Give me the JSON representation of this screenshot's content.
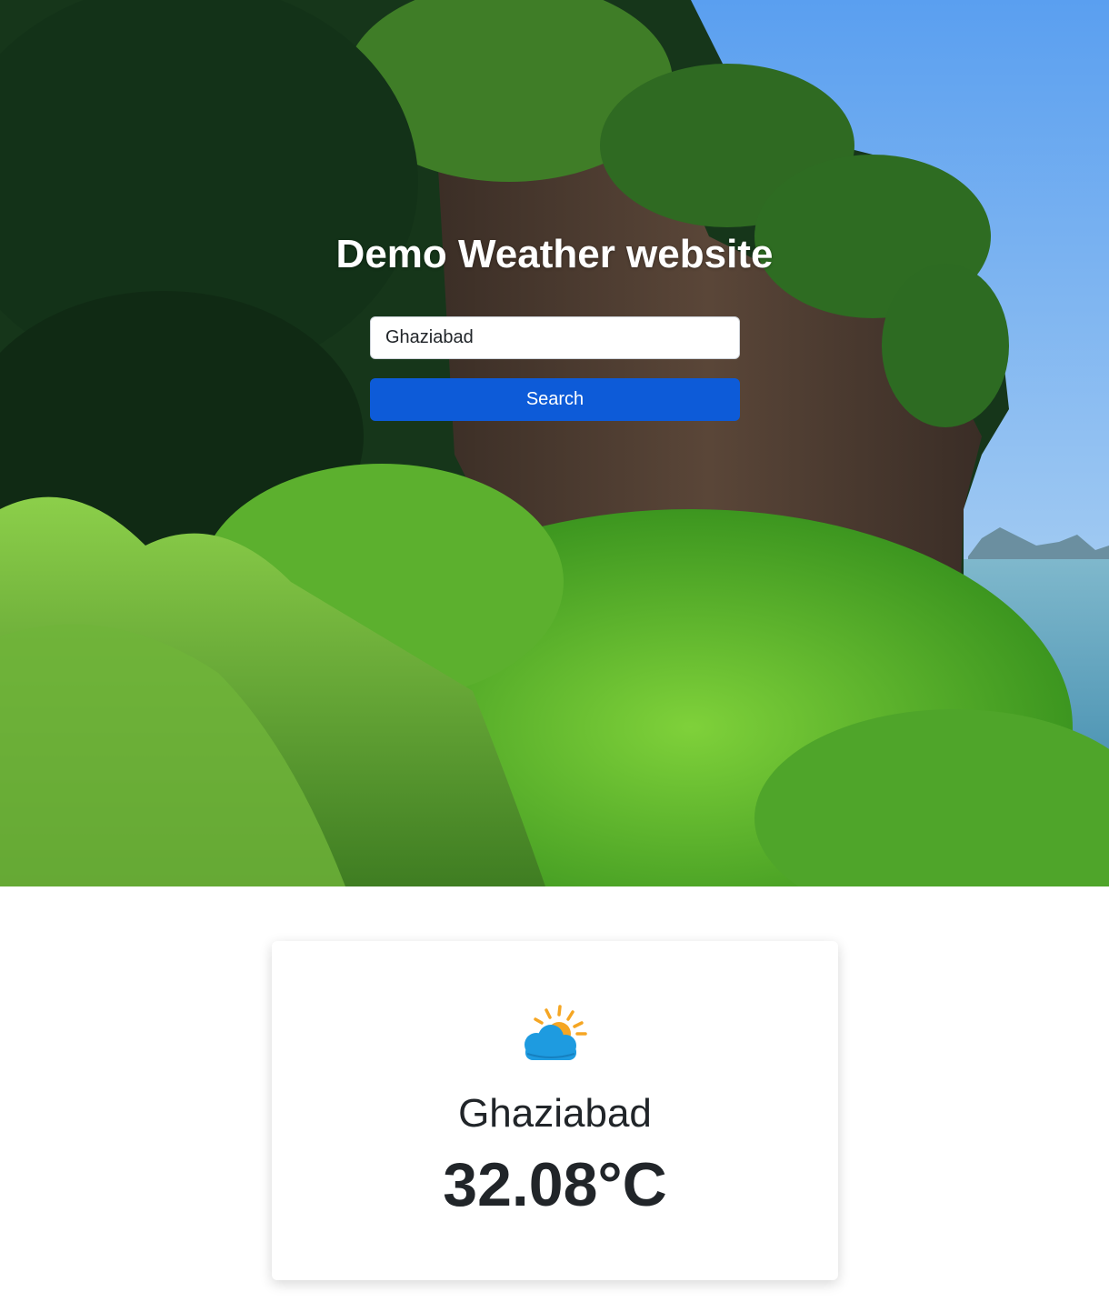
{
  "header": {
    "title": "Demo Weather website"
  },
  "search": {
    "value": "Ghaziabad",
    "button_label": "Search"
  },
  "weather_card": {
    "icon": "partly-cloudy-icon",
    "city": "Ghaziabad",
    "temperature": "32.08°C"
  },
  "colors": {
    "button": "#0d5bd8",
    "text": "#212529",
    "sky": "#5fa8ef",
    "sea": "#3e8fb3",
    "foliage": "#2f7d1f"
  }
}
